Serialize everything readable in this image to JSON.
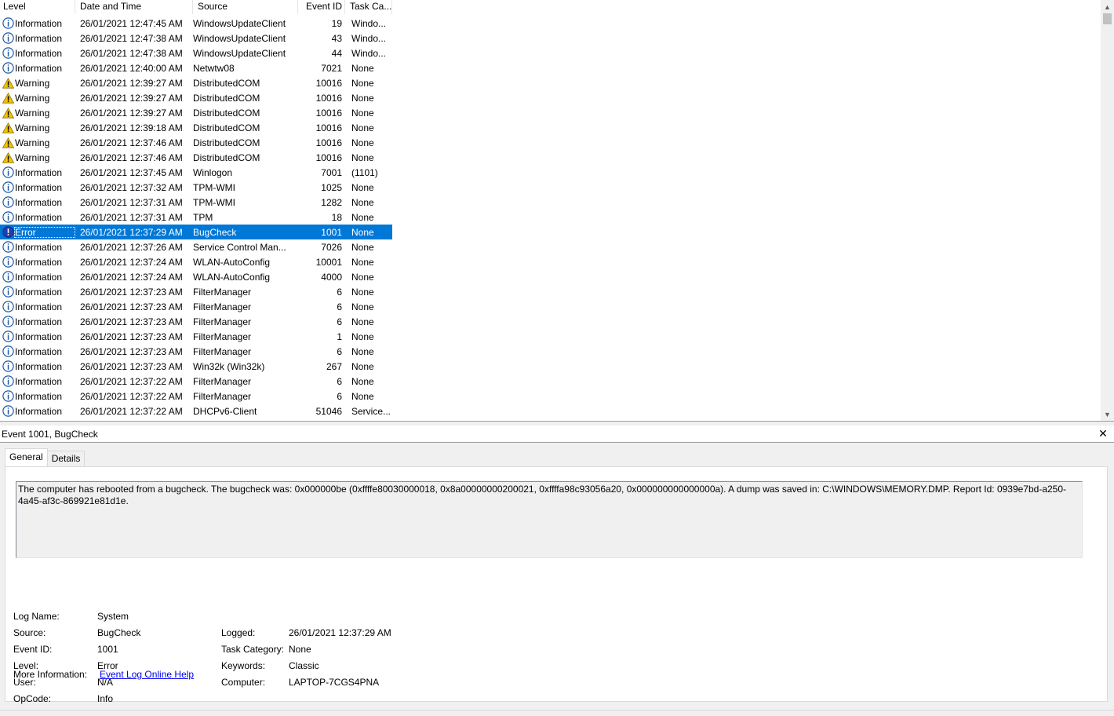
{
  "columns": {
    "level": "Level",
    "date_time": "Date and Time",
    "source": "Source",
    "event_id": "Event ID",
    "task_category": "Task Ca..."
  },
  "events": [
    {
      "level": "Information",
      "icon": "information-icon",
      "date": "26/01/2021 12:47:45 AM",
      "source": "WindowsUpdateClient",
      "event_id": "19",
      "task": "Windo..."
    },
    {
      "level": "Information",
      "icon": "information-icon",
      "date": "26/01/2021 12:47:38 AM",
      "source": "WindowsUpdateClient",
      "event_id": "43",
      "task": "Windo..."
    },
    {
      "level": "Information",
      "icon": "information-icon",
      "date": "26/01/2021 12:47:38 AM",
      "source": "WindowsUpdateClient",
      "event_id": "44",
      "task": "Windo..."
    },
    {
      "level": "Information",
      "icon": "information-icon",
      "date": "26/01/2021 12:40:00 AM",
      "source": "Netwtw08",
      "event_id": "7021",
      "task": "None"
    },
    {
      "level": "Warning",
      "icon": "warning-icon",
      "date": "26/01/2021 12:39:27 AM",
      "source": "DistributedCOM",
      "event_id": "10016",
      "task": "None"
    },
    {
      "level": "Warning",
      "icon": "warning-icon",
      "date": "26/01/2021 12:39:27 AM",
      "source": "DistributedCOM",
      "event_id": "10016",
      "task": "None"
    },
    {
      "level": "Warning",
      "icon": "warning-icon",
      "date": "26/01/2021 12:39:27 AM",
      "source": "DistributedCOM",
      "event_id": "10016",
      "task": "None"
    },
    {
      "level": "Warning",
      "icon": "warning-icon",
      "date": "26/01/2021 12:39:18 AM",
      "source": "DistributedCOM",
      "event_id": "10016",
      "task": "None"
    },
    {
      "level": "Warning",
      "icon": "warning-icon",
      "date": "26/01/2021 12:37:46 AM",
      "source": "DistributedCOM",
      "event_id": "10016",
      "task": "None"
    },
    {
      "level": "Warning",
      "icon": "warning-icon",
      "date": "26/01/2021 12:37:46 AM",
      "source": "DistributedCOM",
      "event_id": "10016",
      "task": "None"
    },
    {
      "level": "Information",
      "icon": "information-icon",
      "date": "26/01/2021 12:37:45 AM",
      "source": "Winlogon",
      "event_id": "7001",
      "task": "(1101)"
    },
    {
      "level": "Information",
      "icon": "information-icon",
      "date": "26/01/2021 12:37:32 AM",
      "source": "TPM-WMI",
      "event_id": "1025",
      "task": "None"
    },
    {
      "level": "Information",
      "icon": "information-icon",
      "date": "26/01/2021 12:37:31 AM",
      "source": "TPM-WMI",
      "event_id": "1282",
      "task": "None"
    },
    {
      "level": "Information",
      "icon": "information-icon",
      "date": "26/01/2021 12:37:31 AM",
      "source": "TPM",
      "event_id": "18",
      "task": "None"
    },
    {
      "level": "Error",
      "icon": "error-icon",
      "date": "26/01/2021 12:37:29 AM",
      "source": "BugCheck",
      "event_id": "1001",
      "task": "None",
      "selected": true
    },
    {
      "level": "Information",
      "icon": "information-icon",
      "date": "26/01/2021 12:37:26 AM",
      "source": "Service Control Man...",
      "event_id": "7026",
      "task": "None"
    },
    {
      "level": "Information",
      "icon": "information-icon",
      "date": "26/01/2021 12:37:24 AM",
      "source": "WLAN-AutoConfig",
      "event_id": "10001",
      "task": "None"
    },
    {
      "level": "Information",
      "icon": "information-icon",
      "date": "26/01/2021 12:37:24 AM",
      "source": "WLAN-AutoConfig",
      "event_id": "4000",
      "task": "None"
    },
    {
      "level": "Information",
      "icon": "information-icon",
      "date": "26/01/2021 12:37:23 AM",
      "source": "FilterManager",
      "event_id": "6",
      "task": "None"
    },
    {
      "level": "Information",
      "icon": "information-icon",
      "date": "26/01/2021 12:37:23 AM",
      "source": "FilterManager",
      "event_id": "6",
      "task": "None"
    },
    {
      "level": "Information",
      "icon": "information-icon",
      "date": "26/01/2021 12:37:23 AM",
      "source": "FilterManager",
      "event_id": "6",
      "task": "None"
    },
    {
      "level": "Information",
      "icon": "information-icon",
      "date": "26/01/2021 12:37:23 AM",
      "source": "FilterManager",
      "event_id": "1",
      "task": "None"
    },
    {
      "level": "Information",
      "icon": "information-icon",
      "date": "26/01/2021 12:37:23 AM",
      "source": "FilterManager",
      "event_id": "6",
      "task": "None"
    },
    {
      "level": "Information",
      "icon": "information-icon",
      "date": "26/01/2021 12:37:23 AM",
      "source": "Win32k (Win32k)",
      "event_id": "267",
      "task": "None"
    },
    {
      "level": "Information",
      "icon": "information-icon",
      "date": "26/01/2021 12:37:22 AM",
      "source": "FilterManager",
      "event_id": "6",
      "task": "None"
    },
    {
      "level": "Information",
      "icon": "information-icon",
      "date": "26/01/2021 12:37:22 AM",
      "source": "FilterManager",
      "event_id": "6",
      "task": "None"
    },
    {
      "level": "Information",
      "icon": "information-icon",
      "date": "26/01/2021 12:37:22 AM",
      "source": "DHCPv6-Client",
      "event_id": "51046",
      "task": "Service..."
    }
  ],
  "detail": {
    "title": "Event 1001, BugCheck",
    "close_glyph": "✕",
    "tabs": [
      {
        "label": "General",
        "active": true
      },
      {
        "label": "Details",
        "active": false
      }
    ],
    "description": "The computer has rebooted from a bugcheck.  The bugcheck was: 0x000000be (0xffffe80030000018, 0x8a00000000200021, 0xffffa98c93056a20, 0x000000000000000a). A dump was saved in: C:\\WINDOWS\\MEMORY.DMP. Report Id: 0939e7bd-a250-4a45-af3c-869921e81d1e.",
    "fields": {
      "log_name_label": "Log Name:",
      "log_name": "System",
      "source_label": "Source:",
      "source": "BugCheck",
      "event_id_label": "Event ID:",
      "event_id": "1001",
      "level_label": "Level:",
      "level": "Error",
      "user_label": "User:",
      "user": "N/A",
      "opcode_label": "OpCode:",
      "opcode": "Info",
      "more_info_label": "More Information:",
      "more_info_link": "Event Log Online Help",
      "logged_label": "Logged:",
      "logged": "26/01/2021 12:37:29 AM",
      "task_category_label": "Task Category:",
      "task_category": "None",
      "keywords_label": "Keywords:",
      "keywords": "Classic",
      "computer_label": "Computer:",
      "computer": "LAPTOP-7CGS4PNA"
    }
  },
  "colors": {
    "selection": "#0078d7",
    "info_icon": "#1e5aa8",
    "warning_icon": "#f5c400",
    "error_icon": "#1e3fae",
    "link": "#0000ee"
  }
}
